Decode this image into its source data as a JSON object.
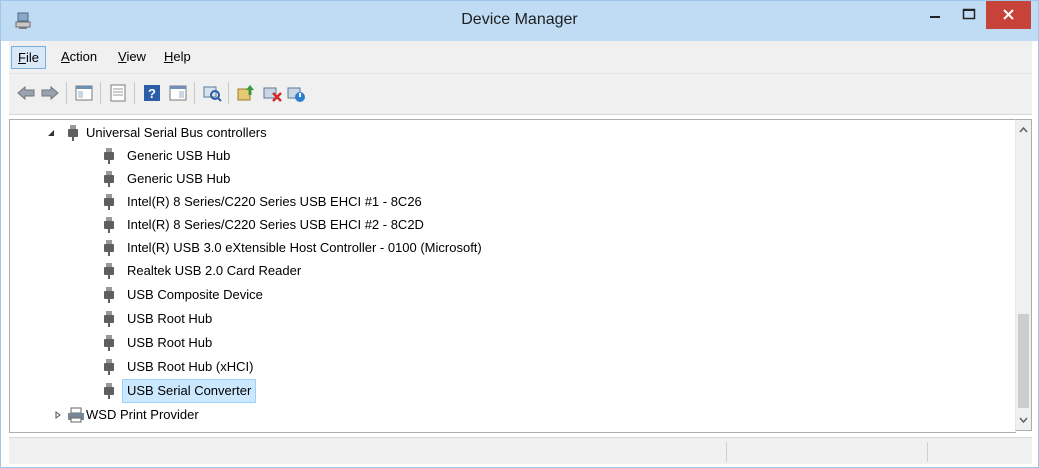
{
  "window": {
    "title": "Device Manager",
    "controls": {
      "minimize": "minimize",
      "maximize": "maximize",
      "close": "close"
    }
  },
  "menubar": {
    "items": [
      {
        "label_u": "F",
        "label_rest": "ile"
      },
      {
        "label_u": "A",
        "label_rest": "ction"
      },
      {
        "label_u": "V",
        "label_rest": "iew"
      },
      {
        "label_u": "H",
        "label_rest": "elp"
      }
    ]
  },
  "toolbar": {
    "buttons": [
      "back-icon",
      "forward-icon",
      "show-hide-console-tree-icon",
      "properties-icon",
      "help-icon",
      "show-action-pane-icon",
      "scan-hardware-changes-icon",
      "update-driver-icon",
      "uninstall-icon",
      "enable-device-icon"
    ]
  },
  "tree": {
    "category": "Universal Serial Bus controllers",
    "devices": [
      "Generic USB Hub",
      "Generic USB Hub",
      "Intel(R) 8 Series/C220 Series USB EHCI #1 - 8C26",
      "Intel(R) 8 Series/C220 Series USB EHCI #2 - 8C2D",
      "Intel(R) USB 3.0 eXtensible Host Controller - 0100 (Microsoft)",
      "Realtek USB 2.0 Card Reader",
      "USB Composite Device",
      "USB Root Hub",
      "USB Root Hub",
      "USB Root Hub (xHCI)",
      "USB Serial Converter"
    ],
    "selected": "USB Serial Converter",
    "next_category": "WSD Print Provider"
  },
  "colors": {
    "titlebar": "#bfdcf4",
    "close": "#c7433a",
    "selection": "#cce8ff"
  }
}
